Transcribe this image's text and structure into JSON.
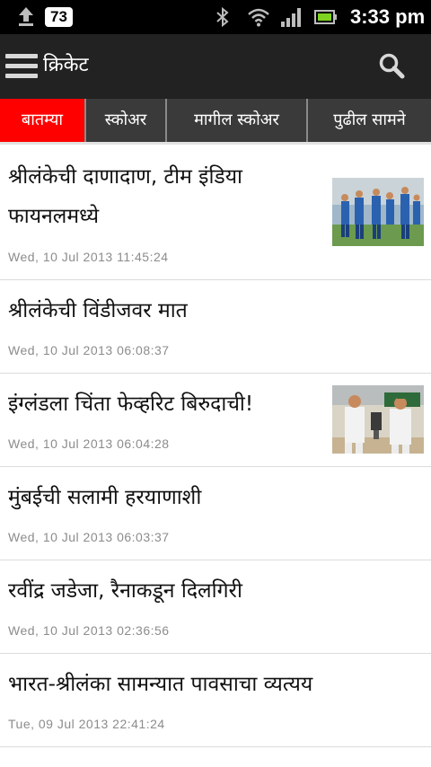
{
  "status_bar": {
    "battery_badge": "73",
    "time": "3:33 pm"
  },
  "header": {
    "title": "क्रिकेट"
  },
  "tabs": [
    {
      "label": "बातम्या",
      "active": true
    },
    {
      "label": "स्कोअर",
      "active": false
    },
    {
      "label": "मागील स्कोअर",
      "active": false
    },
    {
      "label": "पुढील सामने",
      "active": false
    }
  ],
  "news": [
    {
      "title_line1": "श्रीलंकेची दाणादाण, टीम इंडिया",
      "title_line2": "फायनलमध्ये",
      "date": "Wed, 10 Jul 2013 11:45:24",
      "thumbnail": "team-india-celebration-thumbnail"
    },
    {
      "title": "श्रीलंकेची विंडीजवर मात",
      "date": "Wed, 10 Jul 2013 06:08:37"
    },
    {
      "title": "इंग्लंडला चिंता फेव्हरिट बिरुदाची!",
      "date": "Wed, 10 Jul 2013 06:04:28",
      "thumbnail": "trophy-handshake-thumbnail"
    },
    {
      "title": "मुंबईची सलामी हरयाणाशी",
      "date": "Wed, 10 Jul 2013 06:03:37"
    },
    {
      "title": "रवींद्र जडेजा, रैनाकडून दिलगिरी",
      "date": "Wed, 10 Jul 2013 02:36:56"
    },
    {
      "title": "भारत-श्रीलंका सामन्यात पावसाचा व्यत्यय",
      "date": "Tue, 09 Jul 2013 22:41:24"
    }
  ],
  "colors": {
    "active_tab": "#ff0000",
    "action_bar": "#222222",
    "tab_bar": "#3a3a3a",
    "date_text": "#8c8c8c"
  }
}
